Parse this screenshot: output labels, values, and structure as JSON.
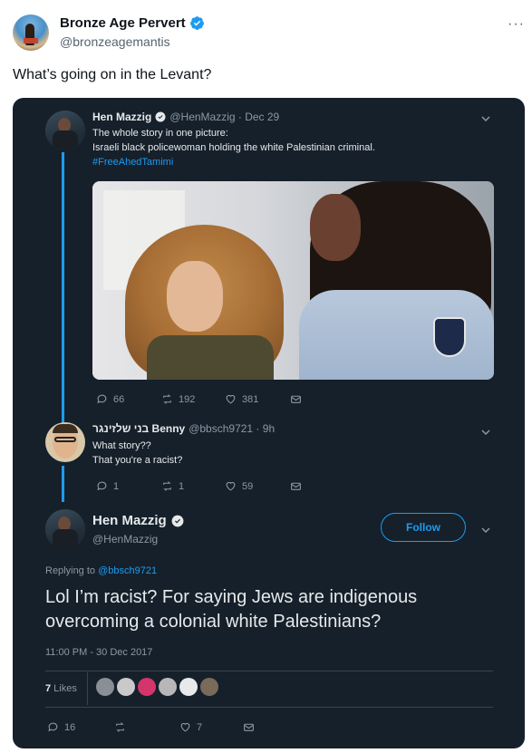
{
  "outer": {
    "author_name": "Bronze Age Pervert",
    "author_handle": "@bronzeagemantis",
    "more": "···",
    "text": "What’s going on in the Levant?"
  },
  "shot": {
    "tweet1": {
      "name": "Hen Mazzig",
      "meta": "@HenMazzig · Dec 29",
      "line1": "The whole story in one picture:",
      "line2": "Israeli black policewoman holding the white Palestinian criminal.",
      "hashtag": "#FreeAhedTamimi",
      "replies": "66",
      "retweets": "192",
      "likes": "381"
    },
    "tweet2": {
      "name": "בני שלזינגר Benny",
      "meta": "@bbsch9721 · 9h",
      "line1": "What story??",
      "line2": "That you're a racist?",
      "replies": "1",
      "retweets": "1",
      "likes": "59"
    },
    "tweet3": {
      "name": "Hen Mazzig",
      "handle": "@HenMazzig",
      "follow": "Follow",
      "replying_prefix": "Replying to ",
      "replying_to": "@bbsch9721",
      "text": "Lol I’m racist? For saying Jews are indigenous overcoming a colonial white Palestinians?",
      "timestamp": "11:00 PM - 30 Dec 2017",
      "likes_count": "7",
      "likes_label": " Likes",
      "replies": "16",
      "retweets": "",
      "likes": "7"
    }
  },
  "colors": {
    "accent": "#1d9bf0",
    "dark_bg": "#15202b",
    "muted": "#8b98a5"
  },
  "icons": [
    "verified-badge-icon",
    "more-icon",
    "chevron-down-icon",
    "reply-icon",
    "retweet-icon",
    "like-icon",
    "message-icon"
  ]
}
